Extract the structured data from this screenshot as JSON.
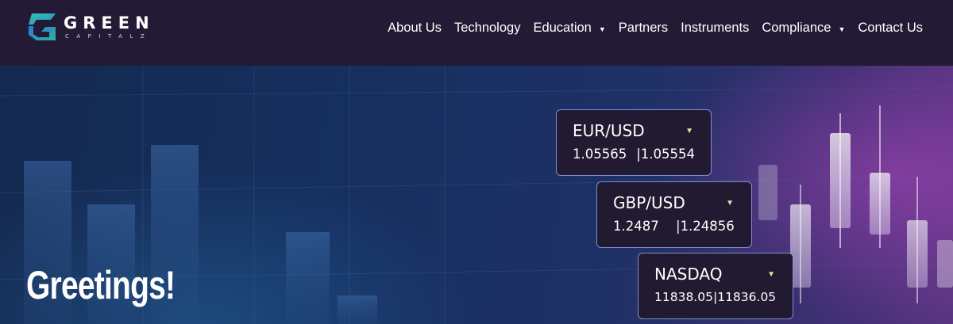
{
  "brand": {
    "word": "GREEN",
    "sub": "CAPITALZ"
  },
  "nav": {
    "items": [
      {
        "label": "About Us",
        "dropdown": false
      },
      {
        "label": "Technology",
        "dropdown": false
      },
      {
        "label": "Education",
        "dropdown": true
      },
      {
        "label": "Partners",
        "dropdown": false
      },
      {
        "label": "Instruments",
        "dropdown": false
      },
      {
        "label": "Compliance",
        "dropdown": true
      },
      {
        "label": "Contact Us",
        "dropdown": false
      }
    ],
    "caret": "▼"
  },
  "hero": {
    "greeting": "Greetings!"
  },
  "tickers": [
    {
      "name": "EUR/USD",
      "bid": "1.05565",
      "ask": "1.05554"
    },
    {
      "name": "GBP/USD",
      "bid": "1.2487",
      "ask": "1.24856"
    },
    {
      "name": "NASDAQ",
      "bid": "11838.05",
      "ask": "11836.05"
    }
  ],
  "colors": {
    "nav_bg": "#231b35",
    "ticker_bg": "#211a30",
    "ticker_border": "#7c8ecf",
    "logo_teal": "#2bb3a6",
    "logo_blue": "#2a6fc9",
    "caret_gold": "#e9d9a8"
  }
}
